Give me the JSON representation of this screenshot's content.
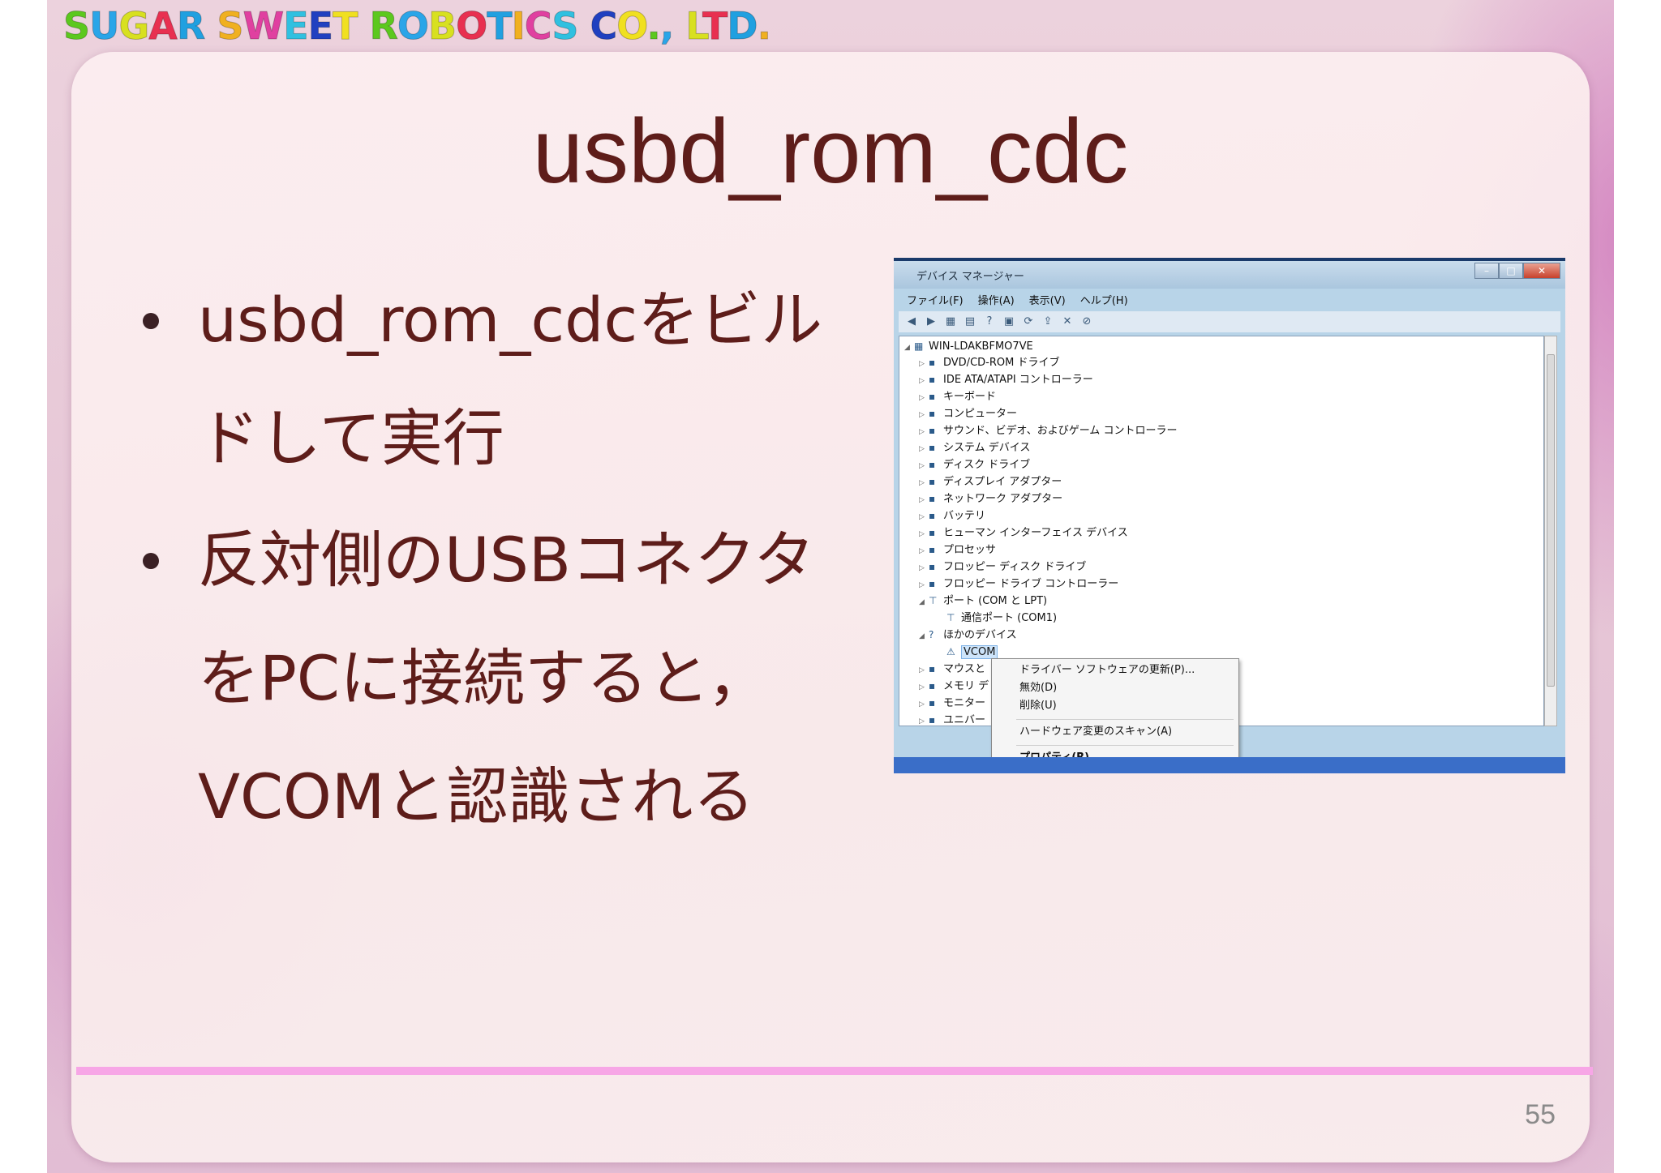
{
  "logo": {
    "text": "SUGAR SWEET ROBOTICS CO., LTD.",
    "colors": [
      "#5cc81e",
      "#2aa5e8",
      "#d8e020",
      "#e83050",
      "#20a0e0",
      "#f0b020",
      "#e040a0",
      "#30c0e0",
      "#2040c0",
      "#f0e020"
    ]
  },
  "slide": {
    "title": "usbd_rom_cdc",
    "bullets": [
      "usbd_rom_cdcをビルドして実行",
      "反対側のUSBコネクタをPCに接続すると，VCOMと認識される"
    ],
    "page_number": "55",
    "divider_color": "#f7a6e6"
  },
  "device_manager": {
    "window_title": "デバイス マネージャー",
    "menus": [
      "ファイル(F)",
      "操作(A)",
      "表示(V)",
      "ヘルプ(H)"
    ],
    "toolbar_icons": [
      "back-arrow-icon",
      "forward-arrow-icon",
      "computer-icon",
      "properties-icon",
      "help-icon",
      "view-icon",
      "scan-icon",
      "update-driver-icon",
      "uninstall-icon",
      "disable-icon"
    ],
    "root": "WIN-LDAKBFMO7VE",
    "categories": [
      "DVD/CD-ROM ドライブ",
      "IDE ATA/ATAPI コントローラー",
      "キーボード",
      "コンピューター",
      "サウンド、ビデオ、およびゲーム コントローラー",
      "システム デバイス",
      "ディスク ドライブ",
      "ディスプレイ アダプター",
      "ネットワーク アダプター",
      "バッテリ",
      "ヒューマン インターフェイス デバイス",
      "プロセッサ",
      "フロッピー ディスク ドライブ",
      "フロッピー ドライブ コントローラー",
      "ポート (COM と LPT)",
      "通信ポート (COM1)",
      "ほかのデバイス",
      "VCOM",
      "マウスと",
      "メモリ デ",
      "モニター",
      "ユニバー"
    ],
    "context_menu": [
      "ドライバー ソフトウェアの更新(P)...",
      "無効(D)",
      "削除(U)",
      "ハードウェア変更のスキャン(A)",
      "プロパティ(R)"
    ]
  }
}
